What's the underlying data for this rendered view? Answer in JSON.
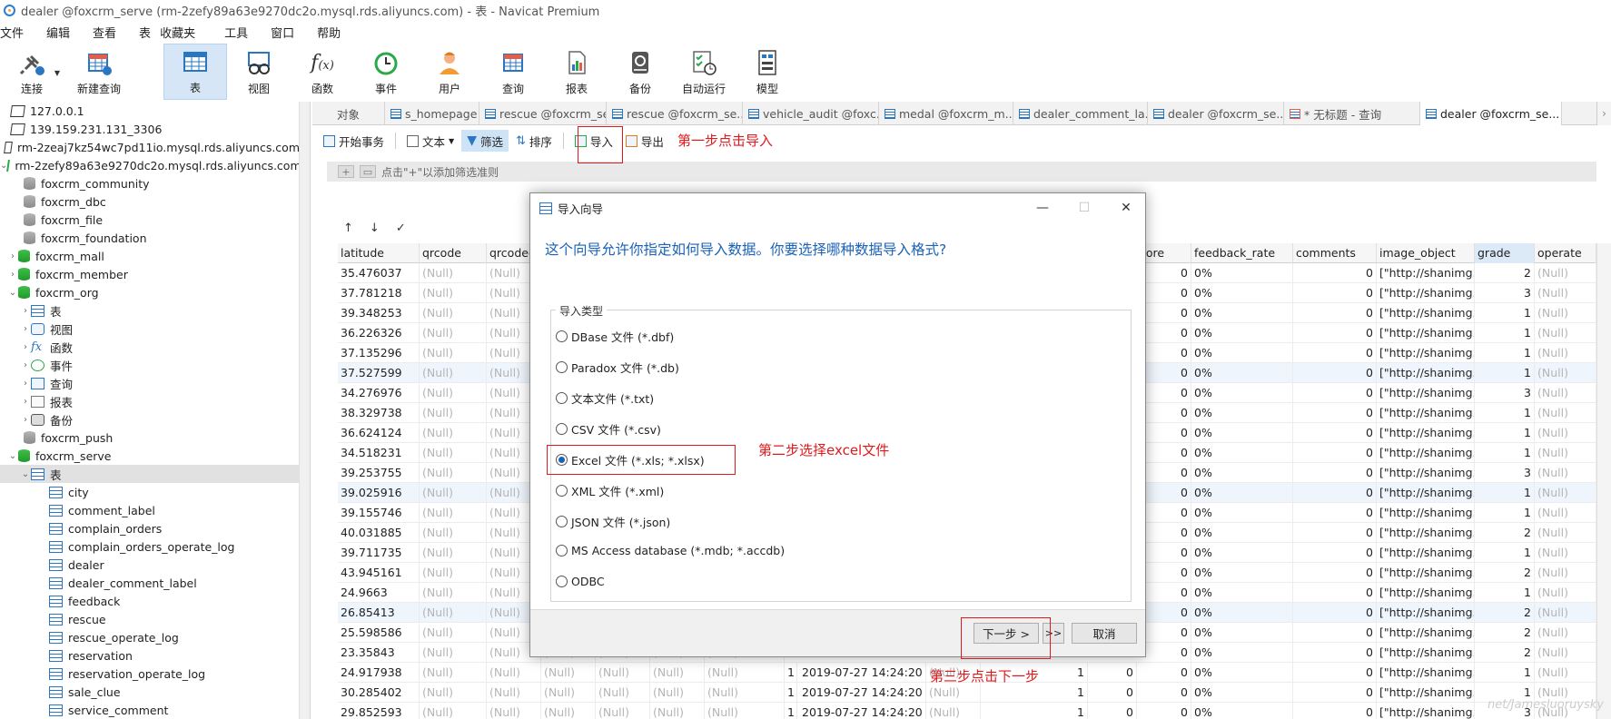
{
  "window": {
    "title": "dealer @foxcrm_serve (rm-2zefy89a63e9270dc2o.mysql.rds.aliyuncs.com) - 表 - Navicat Premium"
  },
  "menu": [
    "文件",
    "编辑",
    "查看",
    "表",
    "收藏夹",
    "工具",
    "窗口",
    "帮助"
  ],
  "toolbar": [
    {
      "label": "连接",
      "icon": "plug-icon"
    },
    {
      "label": "新建查询",
      "icon": "new-query-icon"
    },
    {
      "label": "表",
      "icon": "table-icon"
    },
    {
      "label": "视图",
      "icon": "view-icon"
    },
    {
      "label": "函数",
      "icon": "function-icon"
    },
    {
      "label": "事件",
      "icon": "clock-icon"
    },
    {
      "label": "用户",
      "icon": "user-icon"
    },
    {
      "label": "查询",
      "icon": "query-icon"
    },
    {
      "label": "报表",
      "icon": "report-icon"
    },
    {
      "label": "备份",
      "icon": "backup-icon"
    },
    {
      "label": "自动运行",
      "icon": "autorun-icon"
    },
    {
      "label": "模型",
      "icon": "model-icon"
    }
  ],
  "tree": [
    "127.0.0.1",
    "139.159.231.131_3306",
    "rm-2zeaj7kz54wc7pd11io.mysql.rds.aliyuncs.com",
    "rm-2zefy89a63e9270dc2o.mysql.rds.aliyuncs.com",
    "foxcrm_community",
    "foxcrm_dbc",
    "foxcrm_file",
    "foxcrm_foundation",
    "foxcrm_mall",
    "foxcrm_member",
    "foxcrm_org",
    "表",
    "视图",
    "函数",
    "事件",
    "查询",
    "报表",
    "备份",
    "foxcrm_push",
    "foxcrm_serve",
    "表",
    "city",
    "comment_label",
    "complain_orders",
    "complain_orders_operate_log",
    "dealer",
    "dealer_comment_label",
    "feedback",
    "rescue",
    "rescue_operate_log",
    "reservation",
    "reservation_operate_log",
    "sale_clue",
    "service_comment"
  ],
  "tabs": [
    "对象",
    "s_homepage ...",
    "rescue @foxcrm_se...",
    "rescue @foxcrm_se...",
    "vehicle_audit @foxc...",
    "medal @foxcrm_m...",
    "dealer_comment_la...",
    "dealer @foxcrm_se...",
    "* 无标题 - 查询",
    "dealer @foxcrm_se..."
  ],
  "actions": {
    "begin": "开始事务",
    "text": "文本",
    "filter": "筛选",
    "sort": "排序",
    "import": "导入",
    "export": "导出"
  },
  "filter_hint": "点击\"+\"以添加筛选准则",
  "nav": [
    "↑",
    "↓",
    "✓"
  ],
  "grid": {
    "headers": [
      "latitude",
      "qrcode",
      "qrcodec",
      "core",
      "feedback_rate",
      "comments",
      "image_object",
      "grade",
      "operate"
    ],
    "null_text": "(Null)",
    "rows": [
      {
        "latitude": "35.476037",
        "score": "0",
        "rate": "0%",
        "comments": "0",
        "image": "[\"http://shanimg.o",
        "grade": "2"
      },
      {
        "latitude": "37.781218",
        "score": "0",
        "rate": "0%",
        "comments": "0",
        "image": "[\"http://shanimg.o",
        "grade": "3"
      },
      {
        "latitude": "39.348253",
        "score": "0",
        "rate": "0%",
        "comments": "0",
        "image": "[\"http://shanimg.o",
        "grade": "1"
      },
      {
        "latitude": "36.226326",
        "score": "0",
        "rate": "0%",
        "comments": "0",
        "image": "[\"http://shanimg.o",
        "grade": "1"
      },
      {
        "latitude": "37.135296",
        "score": "0",
        "rate": "0%",
        "comments": "0",
        "image": "[\"http://shanimg.o",
        "grade": "1"
      },
      {
        "latitude": "37.527599",
        "score": "0",
        "rate": "0%",
        "comments": "0",
        "image": "[\"http://shanimg.o",
        "grade": "1"
      },
      {
        "latitude": "34.276976",
        "score": "0",
        "rate": "0%",
        "comments": "0",
        "image": "[\"http://shanimg.o",
        "grade": "3"
      },
      {
        "latitude": "38.329738",
        "score": "0",
        "rate": "0%",
        "comments": "0",
        "image": "[\"http://shanimg.o",
        "grade": "1"
      },
      {
        "latitude": "36.624124",
        "score": "0",
        "rate": "0%",
        "comments": "0",
        "image": "[\"http://shanimg.o",
        "grade": "1"
      },
      {
        "latitude": "34.518231",
        "score": "0",
        "rate": "0%",
        "comments": "0",
        "image": "[\"http://shanimg.o",
        "grade": "1"
      },
      {
        "latitude": "39.253755",
        "score": "0",
        "rate": "0%",
        "comments": "0",
        "image": "[\"http://shanimg.o",
        "grade": "3"
      },
      {
        "latitude": "39.025916",
        "score": "0",
        "rate": "0%",
        "comments": "0",
        "image": "[\"http://shanimg.o",
        "grade": "1"
      },
      {
        "latitude": "39.155746",
        "score": "0",
        "rate": "0%",
        "comments": "0",
        "image": "[\"http://shanimg.o",
        "grade": "1"
      },
      {
        "latitude": "40.031885",
        "score": "0",
        "rate": "0%",
        "comments": "0",
        "image": "[\"http://shanimg.o",
        "grade": "2"
      },
      {
        "latitude": "39.711735",
        "score": "0",
        "rate": "0%",
        "comments": "0",
        "image": "[\"http://shanimg.o",
        "grade": "1"
      },
      {
        "latitude": "43.945161",
        "score": "0",
        "rate": "0%",
        "comments": "0",
        "image": "[\"http://shanimg.o",
        "grade": "2"
      },
      {
        "latitude": "24.9663",
        "score": "0",
        "rate": "0%",
        "comments": "0",
        "image": "[\"http://shanimg.o",
        "grade": "1"
      },
      {
        "latitude": "26.85413",
        "score": "0",
        "rate": "0%",
        "comments": "0",
        "image": "[\"http://shanimg.o",
        "grade": "2"
      },
      {
        "latitude": "25.598586",
        "score": "0",
        "rate": "0%",
        "comments": "0",
        "image": "[\"http://shanimg.o",
        "grade": "2"
      },
      {
        "latitude": "23.35843",
        "score": "0",
        "rate": "0%",
        "comments": "0",
        "image": "[\"http://shanimg.o",
        "grade": "2"
      },
      {
        "latitude": "24.917938",
        "one": "1",
        "date": "2019-07-27 14:24:20",
        "v1": "1",
        "v2": "0",
        "score": "0",
        "rate": "0%",
        "comments": "0",
        "image": "[\"http://shanimg.o",
        "grade": "1"
      },
      {
        "latitude": "30.285402",
        "one": "1",
        "date": "2019-07-27 14:24:20",
        "v1": "1",
        "v2": "0",
        "score": "0",
        "rate": "0%",
        "comments": "0",
        "image": "[\"http://shanimg.o",
        "grade": "1"
      },
      {
        "latitude": "29.852593",
        "one": "1",
        "date": "2019-07-27 14:24:20",
        "v1": "1",
        "v2": "0",
        "score": "0",
        "rate": "0%",
        "comments": "0",
        "image": "[\"http://shanimg.o",
        "grade": "3"
      }
    ]
  },
  "dialog": {
    "title": "导入向导",
    "question": "这个向导允许你指定如何导入数据。你要选择哪种数据导入格式?",
    "group_label": "导入类型",
    "options": [
      "DBase 文件 (*.dbf)",
      "Paradox 文件 (*.db)",
      "文本文件 (*.txt)",
      "CSV 文件 (*.csv)",
      "Excel 文件 (*.xls; *.xlsx)",
      "XML 文件 (*.xml)",
      "JSON 文件 (*.json)",
      "MS Access database (*.mdb; *.accdb)",
      "ODBC"
    ],
    "selected": "Excel 文件 (*.xls; *.xlsx)",
    "next": "下一步 >",
    "skip": ">>",
    "cancel": "取消"
  },
  "annotations": {
    "step1": "第一步点击导入",
    "step2": "第二步选择excel文件",
    "step3": "第三步点击下一步"
  },
  "watermark": "net/Jamesluoruysky",
  "colors": {
    "annotation": "#e0191c",
    "accent": "#1a62b8",
    "selected_tab": "#d6e6f6"
  }
}
